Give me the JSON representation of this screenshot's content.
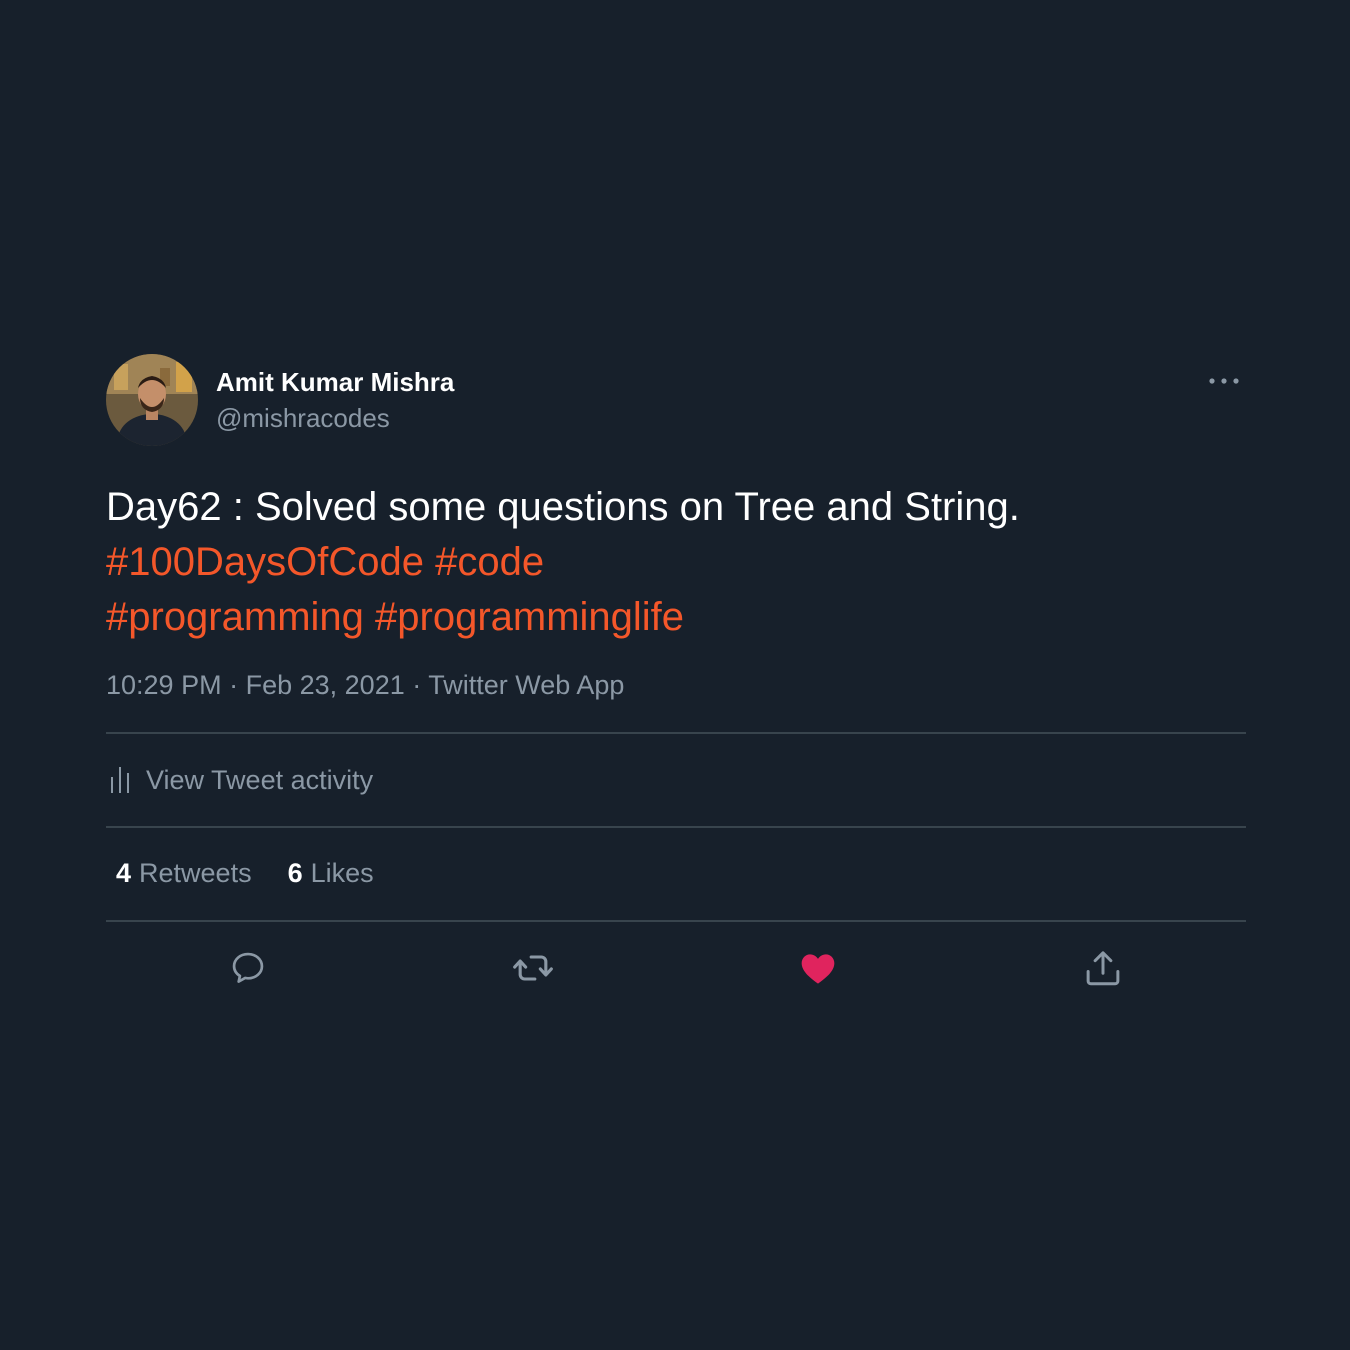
{
  "author": {
    "name": "Amit Kumar Mishra",
    "handle": "@mishracodes"
  },
  "tweet": {
    "text": "Day62 : Solved some questions on Tree and String.",
    "hashtags_line1": [
      "#100DaysOfCode",
      "#code"
    ],
    "hashtags_line2": [
      "#programming",
      "#programminglife"
    ],
    "time": "10:29 PM",
    "separator": "·",
    "date": "Feb 23, 2021",
    "source": "Twitter Web App"
  },
  "activity": {
    "label": "View Tweet activity",
    "icon": "bar-chart-icon"
  },
  "stats": {
    "retweets_count": "4",
    "retweets_label": "Retweets",
    "likes_count": "6",
    "likes_label": "Likes"
  },
  "actions": [
    {
      "name": "reply",
      "icon": "reply-bubble-icon"
    },
    {
      "name": "retweet",
      "icon": "retweet-icon"
    },
    {
      "name": "like",
      "icon": "heart-filled-icon",
      "liked": true
    },
    {
      "name": "share",
      "icon": "share-upload-icon"
    }
  ],
  "colors": {
    "background": "#17202b",
    "text": "#ffffff",
    "secondary_text": "#8b98a5",
    "hashtag": "#f4572a",
    "divider": "#38444d",
    "like": "#e0245e"
  }
}
